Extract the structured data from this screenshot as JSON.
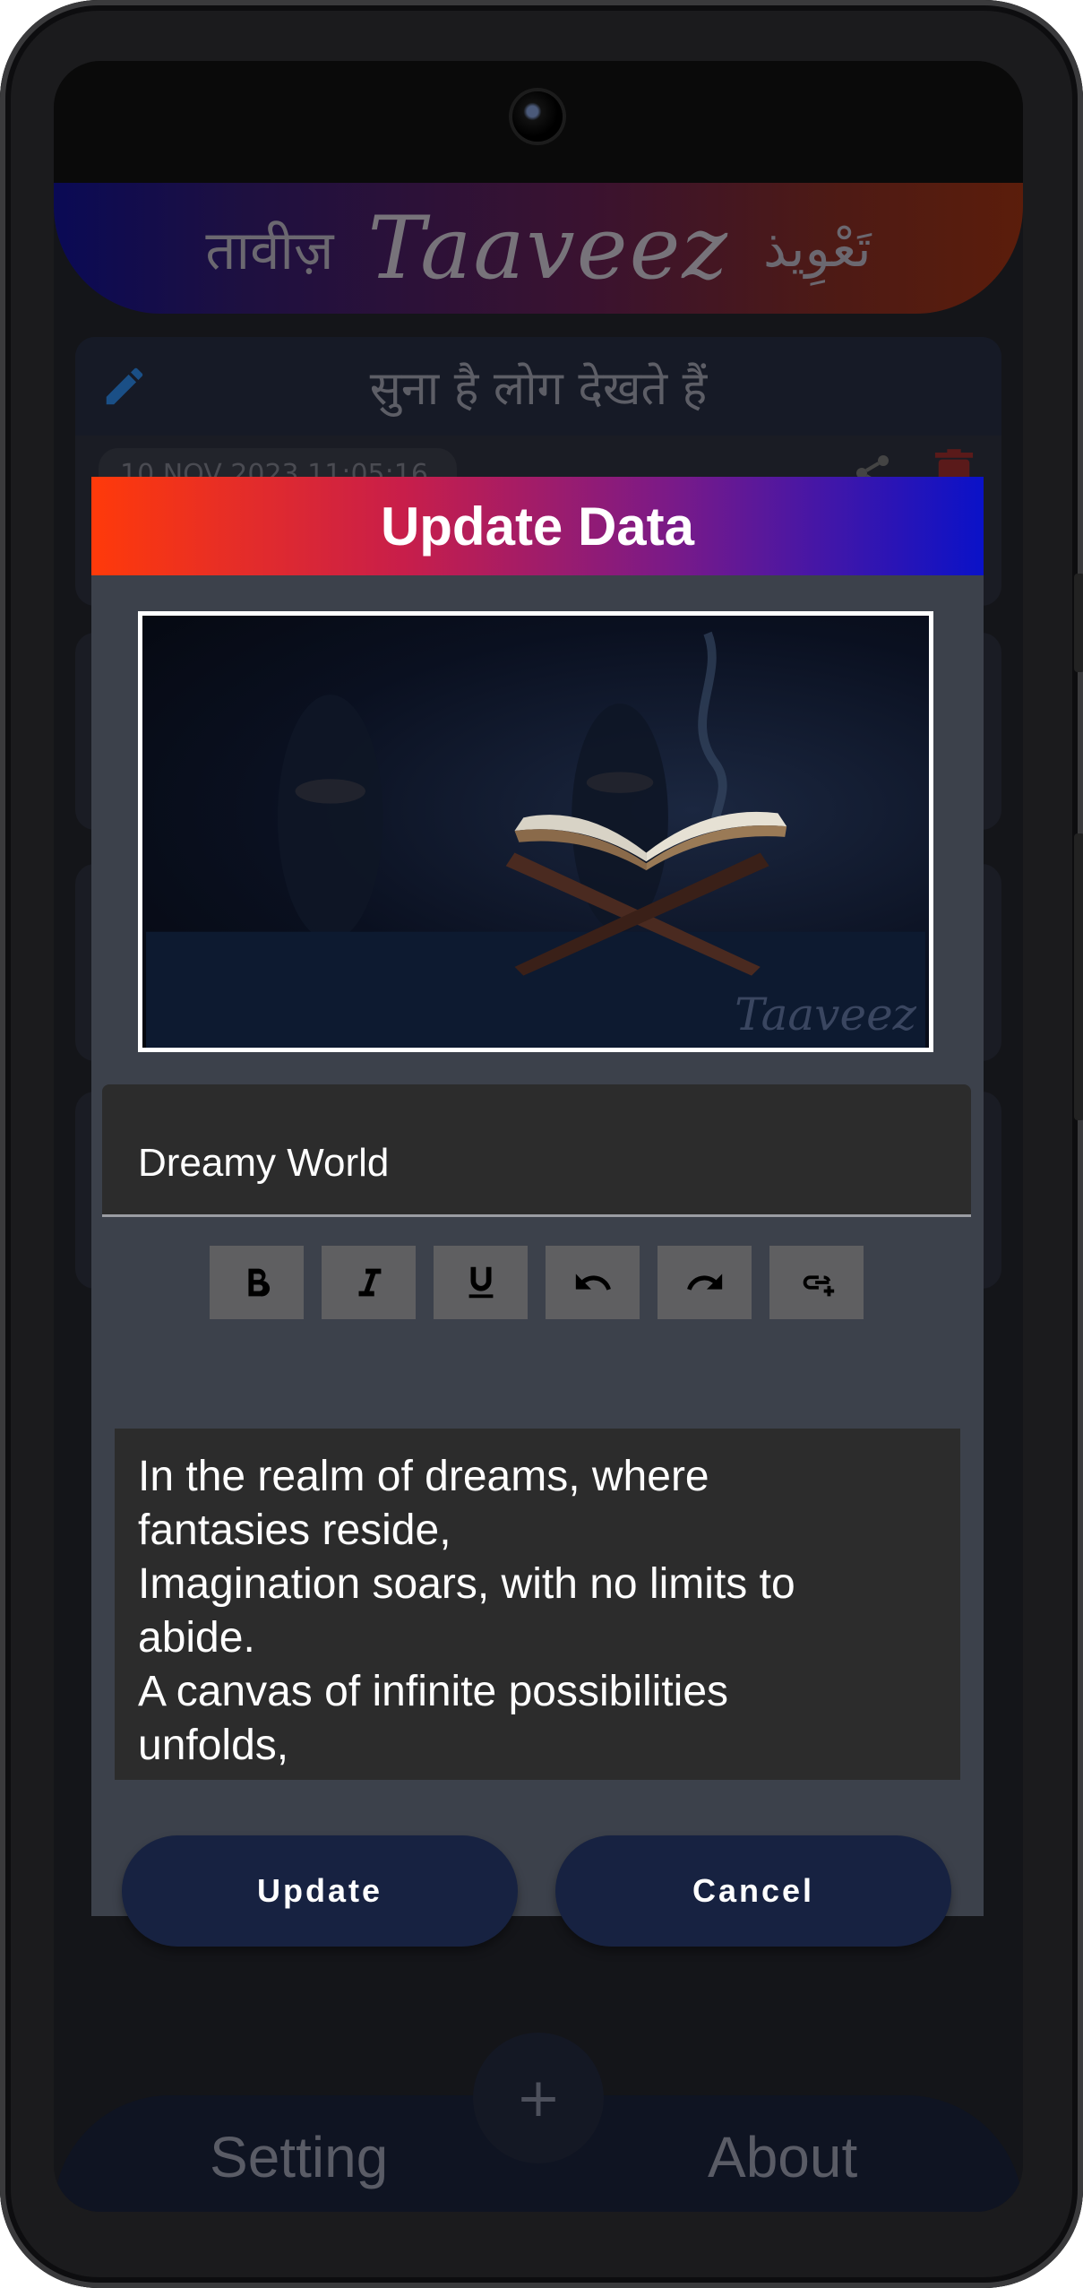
{
  "header": {
    "hindi_name": "तावीज़",
    "logo_text": "Taaveez",
    "urdu_name": "تَعْوِيذ"
  },
  "background_card": {
    "title": "सुना है लोग देखते हैं",
    "date": "10 NOV 2023 11:05:16"
  },
  "dialog": {
    "title": "Update Data",
    "image_watermark": "Taaveez",
    "title_field_value": "Dreamy World",
    "toolbar": [
      "bold-icon",
      "italic-icon",
      "underline-icon",
      "undo-icon",
      "redo-icon",
      "insert-link-icon"
    ],
    "body_lines": [
      "In the realm of dreams, where",
      "fantasies reside,",
      "Imagination soars, with no limits to",
      "abide.",
      "A canvas of infinite possibilities",
      "unfolds,"
    ],
    "update_label": "Update",
    "cancel_label": "Cancel"
  },
  "bottom_nav": {
    "setting_label": "Setting",
    "about_label": "About",
    "fab_label": "+"
  },
  "colors": {
    "dialog_bg": "#3c414b",
    "button_bg": "#172241",
    "title_gradient_start": "#ff3a0a",
    "title_gradient_end": "#0a12c8"
  }
}
